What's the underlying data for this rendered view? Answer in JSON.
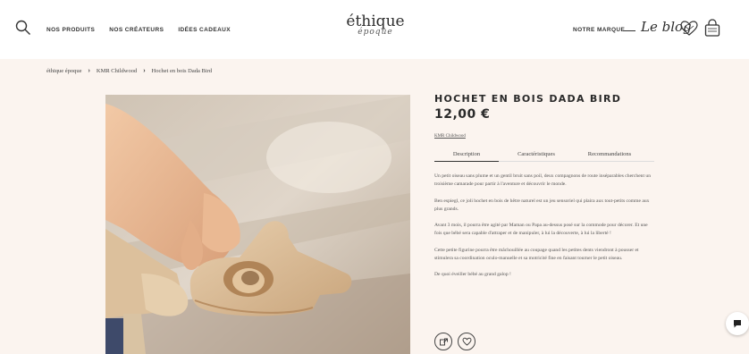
{
  "header": {
    "nav": [
      "NOS PRODUITS",
      "NOS CRÉATEURS",
      "IDÉES CADEAUX"
    ],
    "logo": {
      "main": "éthique",
      "sub": "époque"
    },
    "brand_link": "NOTRE MARQUE",
    "blog": "Le blog"
  },
  "breadcrumb": [
    "éthique époque",
    "KMR Childwood",
    "Hochet en bois Dada Bird"
  ],
  "product": {
    "title": "HOCHET EN BOIS DADA BIRD",
    "price": "12,00 €",
    "brand": "KMR Childwood",
    "tabs": [
      "Description",
      "Caractéristiques",
      "Recommandations"
    ],
    "description": [
      "Un petit oiseau sans plume et un gentil bruit sans poil, deux compagnons de route inséparables cherchent un troisième camarade pour partir à l'aventure et découvrir le monde.",
      "Ben espiegl, ce joli hochet en bois de hêtre naturel est un jeu sensoriel qui plaira aux tout-petits comme aux plus grands.",
      "Avant 3 mois, il pourra être agité par Maman ou Papa au-dessus posé sur la commode pour décorer. Et une fois que bébé sera capable d'attraper et de manipuler, à lui la découverte, à lui la liberté !",
      "Cette petite figurine pourra être mâchouillée au coupage quand les petites dents viendront à pousser et stimulera sa coordination oculo-manuelle et sa motricité fine en faisant tourner le petit oiseau.",
      "De quoi éveiller bébé au grand galop !"
    ]
  },
  "colors": {
    "background": "#fbf4ef",
    "text": "#2a2a2a"
  }
}
